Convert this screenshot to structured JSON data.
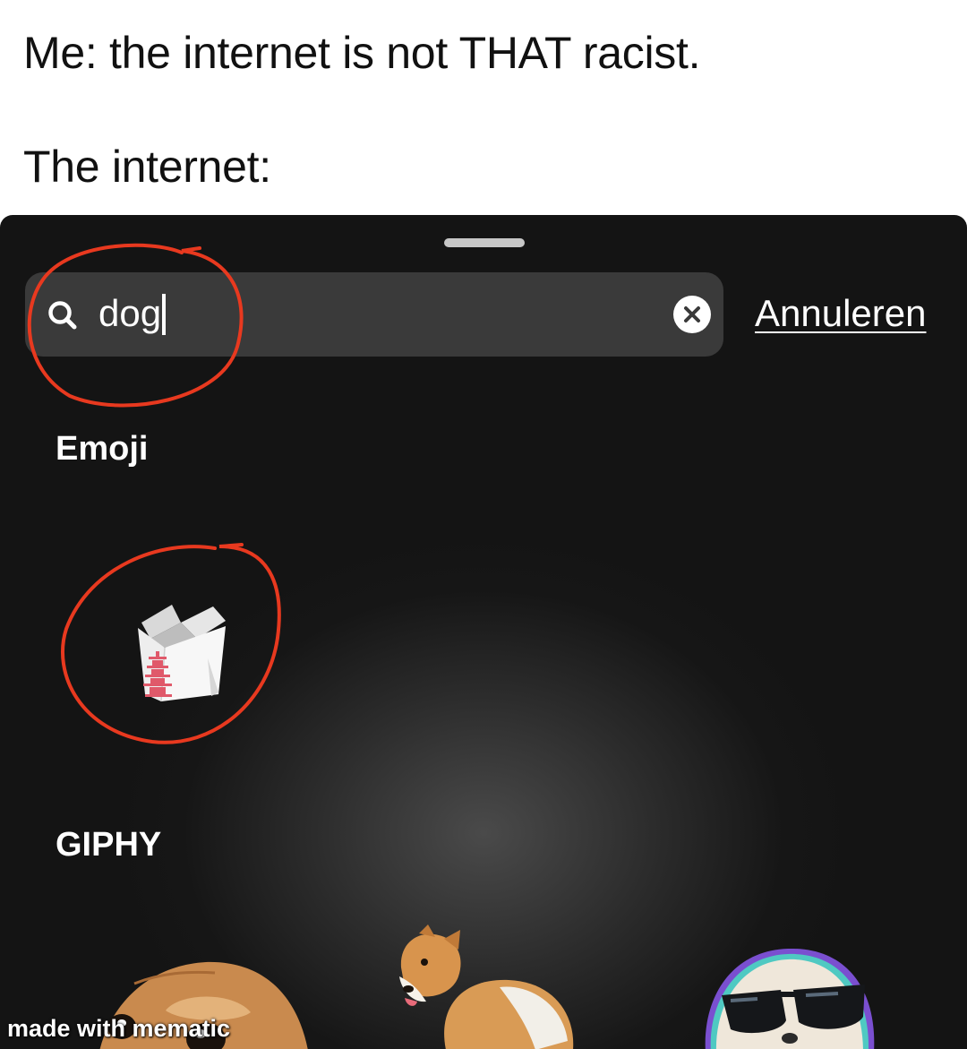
{
  "caption": {
    "line1": "Me: the internet is not THAT racist.",
    "line2": "The internet:"
  },
  "search": {
    "value": "dog",
    "cancel_label": "Annuleren"
  },
  "sections": {
    "emoji_title": "Emoji",
    "giphy_title": "GIPHY"
  },
  "emoji_results": [
    {
      "icon": "takeout-box-icon"
    }
  ],
  "giphy_results": [
    {
      "icon": "chihuahua-sticker"
    },
    {
      "icon": "corgi-sticker"
    },
    {
      "icon": "dog-sunglasses-sticker"
    }
  ],
  "watermark": "made with mematic",
  "colors": {
    "sheet_background": "#141414",
    "search_field": "#3a3a3a",
    "annotation_circle": "#e8391f"
  }
}
